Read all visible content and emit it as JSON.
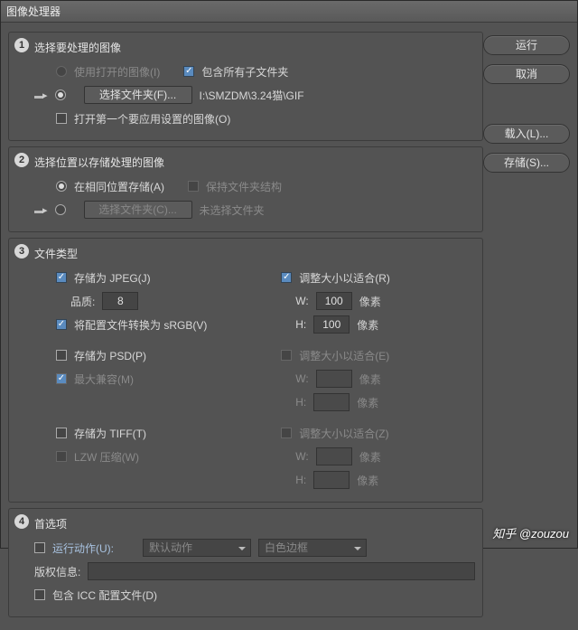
{
  "window": {
    "title": "图像处理器"
  },
  "buttons": {
    "run": "运行",
    "cancel": "取消",
    "load": "载入(L)...",
    "save": "存储(S)..."
  },
  "section1": {
    "num": "1",
    "title": "选择要处理的图像",
    "use_open_images": "使用打开的图像(I)",
    "include_subfolders": "包含所有子文件夹",
    "select_folder_btn": "选择文件夹(F)...",
    "folder_path": "I:\\SMZDM\\3.24猫\\GIF",
    "open_first": "打开第一个要应用设置的图像(O)"
  },
  "section2": {
    "num": "2",
    "title": "选择位置以存储处理的图像",
    "save_same": "在相同位置存储(A)",
    "keep_structure": "保持文件夹结构",
    "select_folder_btn": "选择文件夹(C)...",
    "no_folder": "未选择文件夹"
  },
  "section3": {
    "num": "3",
    "title": "文件类型",
    "jpeg": {
      "save_as": "存储为 JPEG(J)",
      "quality_label": "品质:",
      "quality_value": "8",
      "convert_srgb": "将配置文件转换为 sRGB(V)",
      "resize": "调整大小以适合(R)",
      "w_label": "W:",
      "w_value": "100",
      "h_label": "H:",
      "h_value": "100",
      "unit": "像素"
    },
    "psd": {
      "save_as": "存储为 PSD(P)",
      "max_compat": "最大兼容(M)",
      "resize": "调整大小以适合(E)",
      "w_label": "W:",
      "h_label": "H:",
      "unit": "像素"
    },
    "tiff": {
      "save_as": "存储为 TIFF(T)",
      "lzw": "LZW 压缩(W)",
      "resize": "调整大小以适合(Z)",
      "w_label": "W:",
      "h_label": "H:",
      "unit": "像素"
    }
  },
  "section4": {
    "num": "4",
    "title": "首选项",
    "run_action": "运行动作(U):",
    "action_set": "默认动作",
    "action_name": "白色边框",
    "copyright_label": "版权信息:",
    "copyright_value": "",
    "include_icc": "包含 ICC 配置文件(D)"
  },
  "watermark": "知乎 @zouzou"
}
